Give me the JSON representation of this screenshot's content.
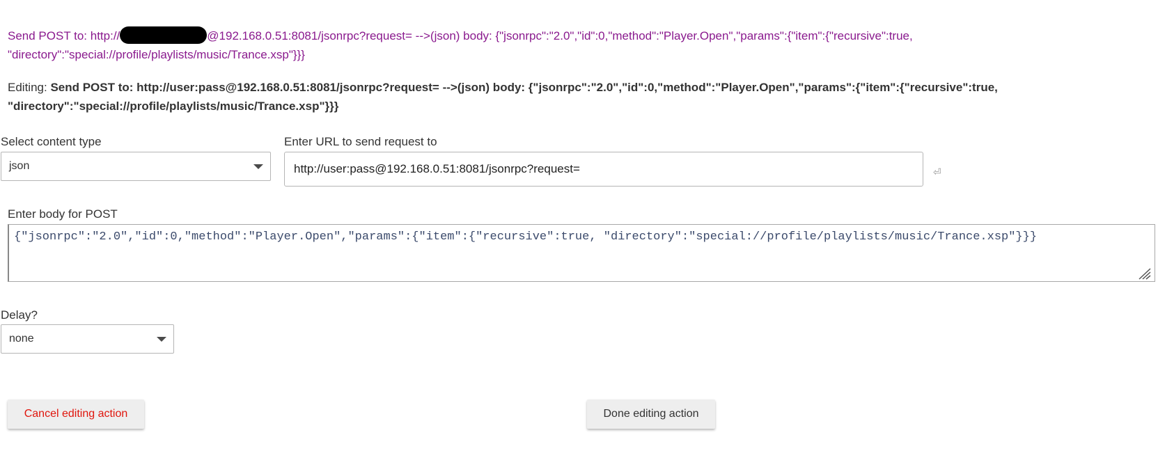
{
  "summary": {
    "prefix": "Send POST to: http://",
    "suffix": "@192.168.0.51:8081/jsonrpc?request= -->(json) body: {\"jsonrpc\":\"2.0\",\"id\":0,\"method\":\"Player.Open\",\"params\":{\"item\":{\"recursive\":true, \"directory\":\"special://profile/playlists/music/Trance.xsp\"}}}"
  },
  "editing": {
    "label": "Editing: ",
    "text": "Send POST to: http://user:pass@192.168.0.51:8081/jsonrpc?request= -->(json) body: {\"jsonrpc\":\"2.0\",\"id\":0,\"method\":\"Player.Open\",\"params\":{\"item\":{\"recursive\":true, \"directory\":\"special://profile/playlists/music/Trance.xsp\"}}}"
  },
  "content_type": {
    "label": "Select content type",
    "value": "json"
  },
  "url": {
    "label": "Enter URL to send request to",
    "value": "http://user:pass@192.168.0.51:8081/jsonrpc?request=",
    "enter_glyph": "⏎"
  },
  "body": {
    "label": "Enter body for POST",
    "value": "{\"jsonrpc\":\"2.0\",\"id\":0,\"method\":\"Player.Open\",\"params\":{\"item\":{\"recursive\":true, \"directory\":\"special://profile/playlists/music/Trance.xsp\"}}}"
  },
  "delay": {
    "label": "Delay?",
    "value": "none"
  },
  "buttons": {
    "cancel": "Cancel editing action",
    "done": "Done editing action"
  },
  "colors": {
    "summary_text": "#8a1a8e",
    "cancel_text": "#e0150c",
    "button_bg": "#eeeeee"
  }
}
